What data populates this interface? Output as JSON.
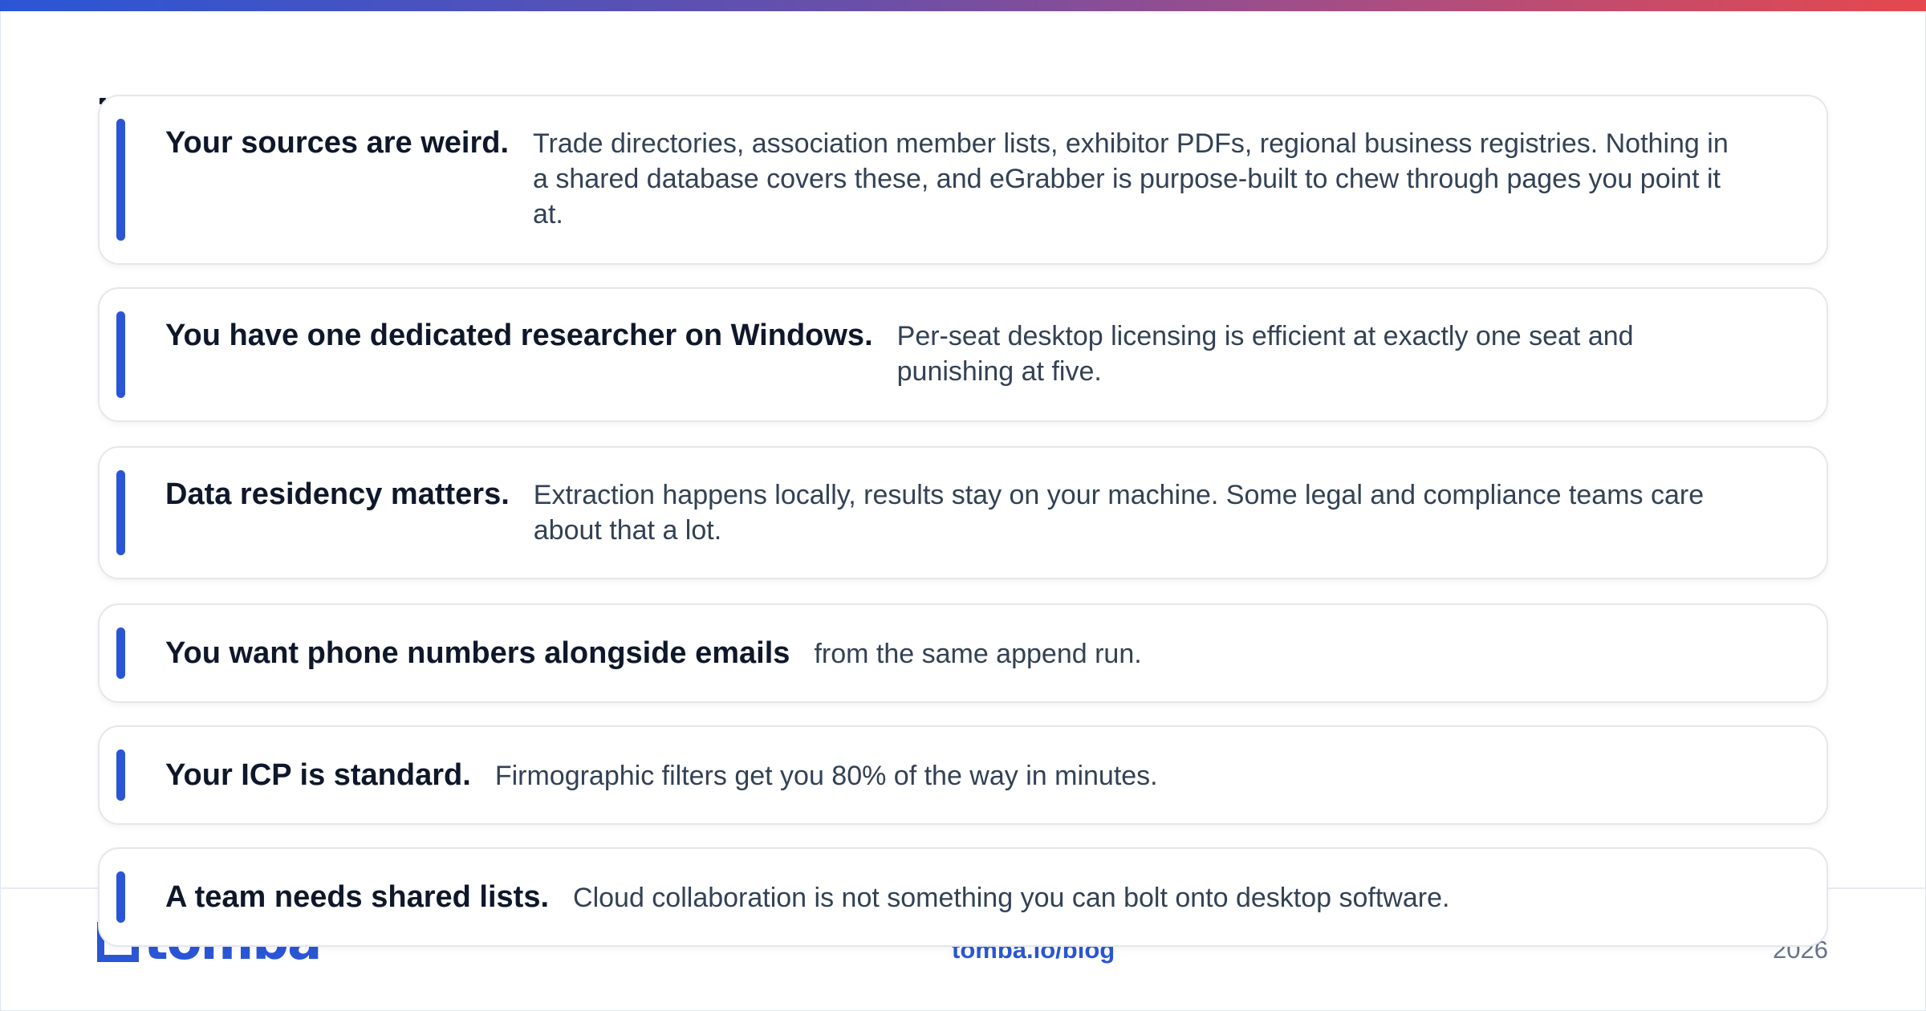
{
  "cards": [
    {
      "title": "Your sources are weird.",
      "description": "Trade directories, association member lists, exhibitor PDFs, regional business registries. Nothing in a shared database covers these, and eGrabber is purpose-built to chew through pages you point it at."
    },
    {
      "title": "You have one dedicated researcher on Windows.",
      "description": "Per-seat desktop licensing is efficient at exactly one seat and punishing at five."
    },
    {
      "title": "Data residency matters.",
      "description": "Extraction happens locally, results stay on your machine. Some legal and compliance teams care about that a lot."
    },
    {
      "title": "You want phone numbers alongside emails",
      "description": "from the same append run."
    },
    {
      "title": "Your ICP is standard.",
      "description": "Firmographic filters get you 80% of the way in minutes."
    },
    {
      "title": "A team needs shared lists.",
      "description": "Cloud collaboration is not something you can bolt onto desktop software."
    }
  ],
  "footer": {
    "logo_text": "tomba",
    "url": "tomba.io/blog",
    "year": "2026"
  },
  "colors": {
    "accent": "#2a56d6",
    "brand_red": "#e5484d",
    "title_text": "#0f172a",
    "body_text": "#334155"
  }
}
